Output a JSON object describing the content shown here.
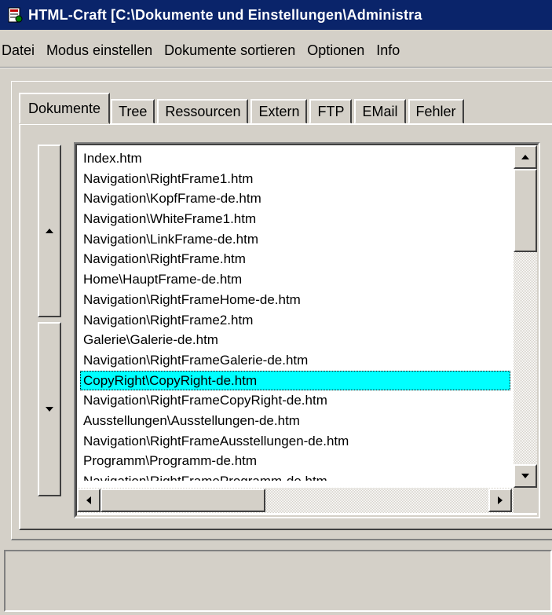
{
  "window": {
    "title": "HTML-Craft  [C:\\Dokumente und Einstellungen\\Administra",
    "icon": "app-icon"
  },
  "menu": [
    {
      "label": "Datei"
    },
    {
      "label": "Modus einstellen"
    },
    {
      "label": "Dokumente sortieren"
    },
    {
      "label": "Optionen"
    },
    {
      "label": "Info"
    }
  ],
  "tabs": [
    {
      "label": "Dokumente",
      "active": true
    },
    {
      "label": "Tree"
    },
    {
      "label": "Ressourcen"
    },
    {
      "label": "Extern"
    },
    {
      "label": "FTP"
    },
    {
      "label": "EMail"
    },
    {
      "label": "Fehler"
    }
  ],
  "side_buttons": {
    "up_icon": "triangle-up-icon",
    "down_icon": "triangle-down-icon"
  },
  "documents": [
    "Index.htm",
    "Navigation\\RightFrame1.htm",
    "Navigation\\KopfFrame-de.htm",
    "Navigation\\WhiteFrame1.htm",
    "Navigation\\LinkFrame-de.htm",
    "Navigation\\RightFrame.htm",
    "Home\\HauptFrame-de.htm",
    "Navigation\\RightFrameHome-de.htm",
    "Navigation\\RightFrame2.htm",
    "Galerie\\Galerie-de.htm",
    "Navigation\\RightFrameGalerie-de.htm",
    "CopyRight\\CopyRight-de.htm",
    "Navigation\\RightFrameCopyRight-de.htm",
    "Ausstellungen\\Ausstellungen-de.htm",
    "Navigation\\RightFrameAusstellungen-de.htm",
    "Programm\\Programm-de.htm",
    "Navigation\\RightFrameProgramm-de.htm"
  ],
  "selected_index": 11,
  "colors": {
    "selection": "#00ffff",
    "titlebar": "#0a246a",
    "face": "#d4d0c8"
  },
  "status_text": ""
}
